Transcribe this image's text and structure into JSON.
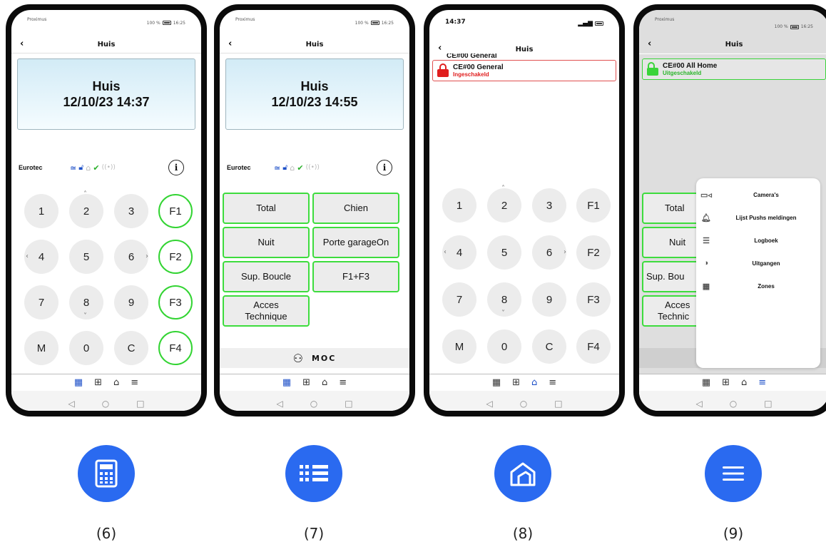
{
  "common": {
    "title": "Huis",
    "status_carrier": "Proximus",
    "status_battery": "100 %",
    "status_time": "16:25",
    "brand": "Eurotec",
    "tabs": [
      "▦",
      "⊞",
      "⌂",
      "≡"
    ]
  },
  "screen6": {
    "lcd_line1": "Huis",
    "lcd_line2": "12/10/23  14:37",
    "keys": [
      "1",
      "2",
      "3",
      "F1",
      "4",
      "5",
      "6",
      "F2",
      "7",
      "8",
      "9",
      "F3",
      "M",
      "0",
      "C",
      "F4"
    ],
    "caption": "(6)"
  },
  "screen7": {
    "lcd_line1": "Huis",
    "lcd_line2": "12/10/23  14:55",
    "buttons": [
      "Total",
      "Chien",
      "Nuit",
      "Porte garageOn",
      "Sup. Boucle",
      "F1+F3",
      "Acces Technique"
    ],
    "moc_label": "MOC",
    "caption": "(7)"
  },
  "screen8": {
    "status_time": "14:37",
    "zone_name_partial": "CE#00 General",
    "zone_name": "CE#00 General",
    "zone_state": "Ingeschakeld",
    "keys": [
      "1",
      "2",
      "3",
      "F1",
      "4",
      "5",
      "6",
      "F2",
      "7",
      "8",
      "9",
      "F3",
      "M",
      "0",
      "C",
      "F4"
    ],
    "caption": "(8)"
  },
  "screen9": {
    "zone_name": "CE#00 All Home",
    "zone_state": "Uitgeschakeld",
    "buttons_partial": [
      "Total",
      "Nuit",
      "Sup. Bou",
      "Acces",
      "Technic"
    ],
    "menu": [
      {
        "icon": "camera-icon",
        "label": "Camera's"
      },
      {
        "icon": "bell-icon",
        "label": "Lijst Pushs meldingen"
      },
      {
        "icon": "list-icon",
        "label": "Logboek"
      },
      {
        "icon": "toggle-icon",
        "label": "Uitgangen"
      },
      {
        "icon": "grid-icon",
        "label": "Zones"
      }
    ],
    "caption": "(9)"
  },
  "colors": {
    "accent_blue": "#2a6af0",
    "key_green": "#33d433",
    "alarm_red": "#e01e1e"
  }
}
